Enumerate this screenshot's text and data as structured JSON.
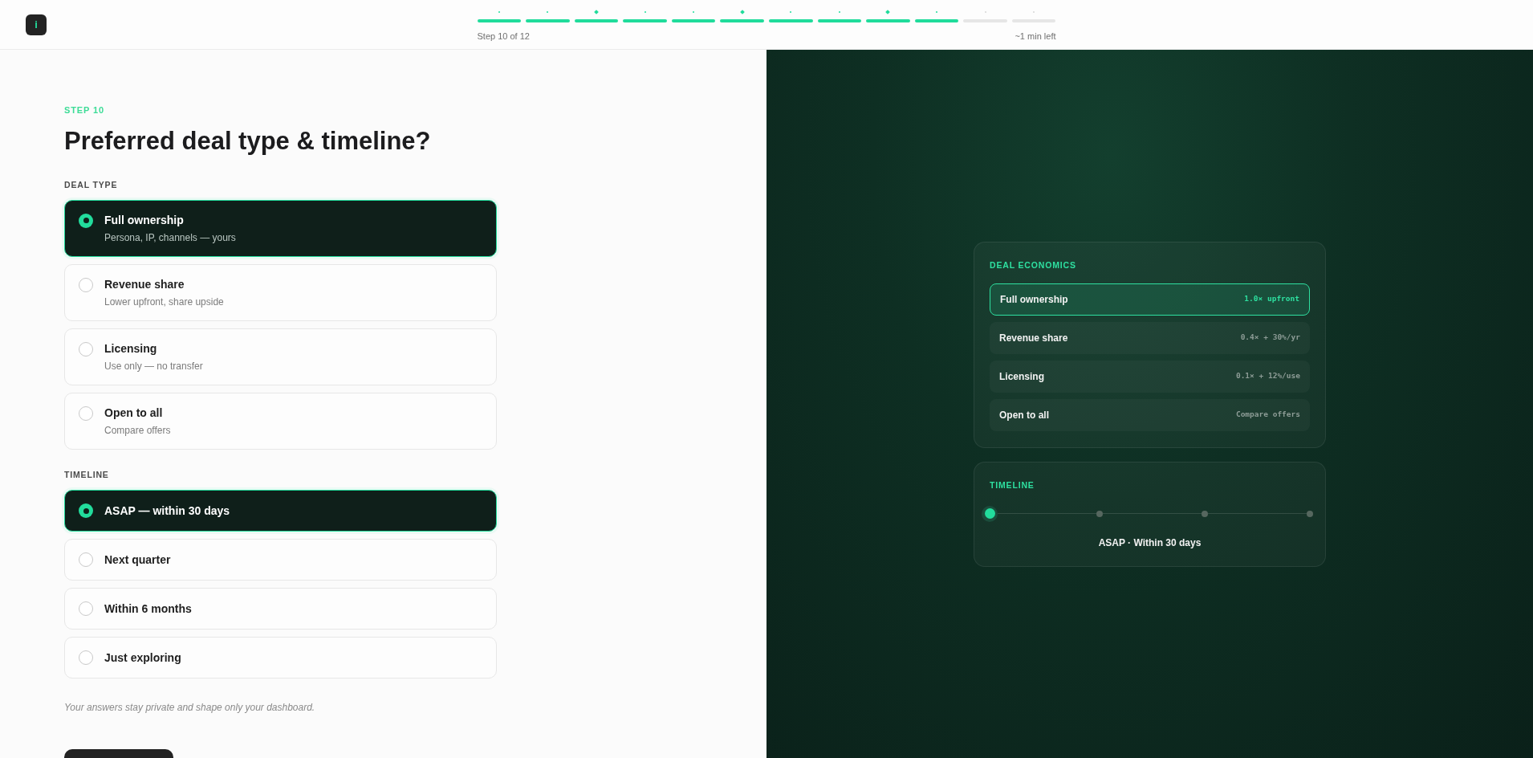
{
  "header": {
    "logo": {
      "letter": "i"
    },
    "progress": {
      "steps": [
        {
          "done": true,
          "milestone": false
        },
        {
          "done": true,
          "milestone": false
        },
        {
          "done": true,
          "milestone": true
        },
        {
          "done": true,
          "milestone": false
        },
        {
          "done": true,
          "milestone": false
        },
        {
          "done": true,
          "milestone": true
        },
        {
          "done": true,
          "milestone": false
        },
        {
          "done": true,
          "milestone": false
        },
        {
          "done": true,
          "milestone": true
        },
        {
          "done": true,
          "milestone": false
        },
        {
          "done": false,
          "milestone": false
        },
        {
          "done": false,
          "milestone": false
        }
      ],
      "label": "Step 10 of 12",
      "remaining": "~1 min left"
    }
  },
  "form": {
    "eyebrow": "STEP 10",
    "title": "Preferred deal type & timeline?",
    "sections": [
      {
        "label": "DEAL TYPE",
        "options": [
          {
            "title": "Full ownership",
            "subtitle": "Persona, IP, channels — yours",
            "selected": true
          },
          {
            "title": "Revenue share",
            "subtitle": "Lower upfront, share upside",
            "selected": false
          },
          {
            "title": "Licensing",
            "subtitle": "Use only — no transfer",
            "selected": false
          },
          {
            "title": "Open to all",
            "subtitle": "Compare offers",
            "selected": false
          }
        ]
      },
      {
        "label": "TIMELINE",
        "options": [
          {
            "title": "ASAP — within 30 days",
            "selected": true
          },
          {
            "title": "Next quarter",
            "selected": false
          },
          {
            "title": "Within 6 months",
            "selected": false
          },
          {
            "title": "Just exploring",
            "selected": false
          }
        ]
      }
    ],
    "note": "Your answers stay private and shape only your dashboard."
  },
  "preview": {
    "deal_economics": {
      "title": "DEAL ECONOMICS",
      "rows": [
        {
          "label": "Full ownership",
          "value": "1.0× upfront",
          "selected": true
        },
        {
          "label": "Revenue share",
          "value": "0.4× + 30%/yr",
          "selected": false
        },
        {
          "label": "Licensing",
          "value": "0.1× + 12%/use",
          "selected": false
        },
        {
          "label": "Open to all",
          "value": "Compare offers",
          "selected": false
        }
      ]
    },
    "timeline": {
      "title": "TIMELINE",
      "stops": [
        {
          "selected": true
        },
        {
          "selected": false
        },
        {
          "selected": false
        },
        {
          "selected": false
        }
      ],
      "caption": "ASAP · Within 30 days"
    }
  }
}
